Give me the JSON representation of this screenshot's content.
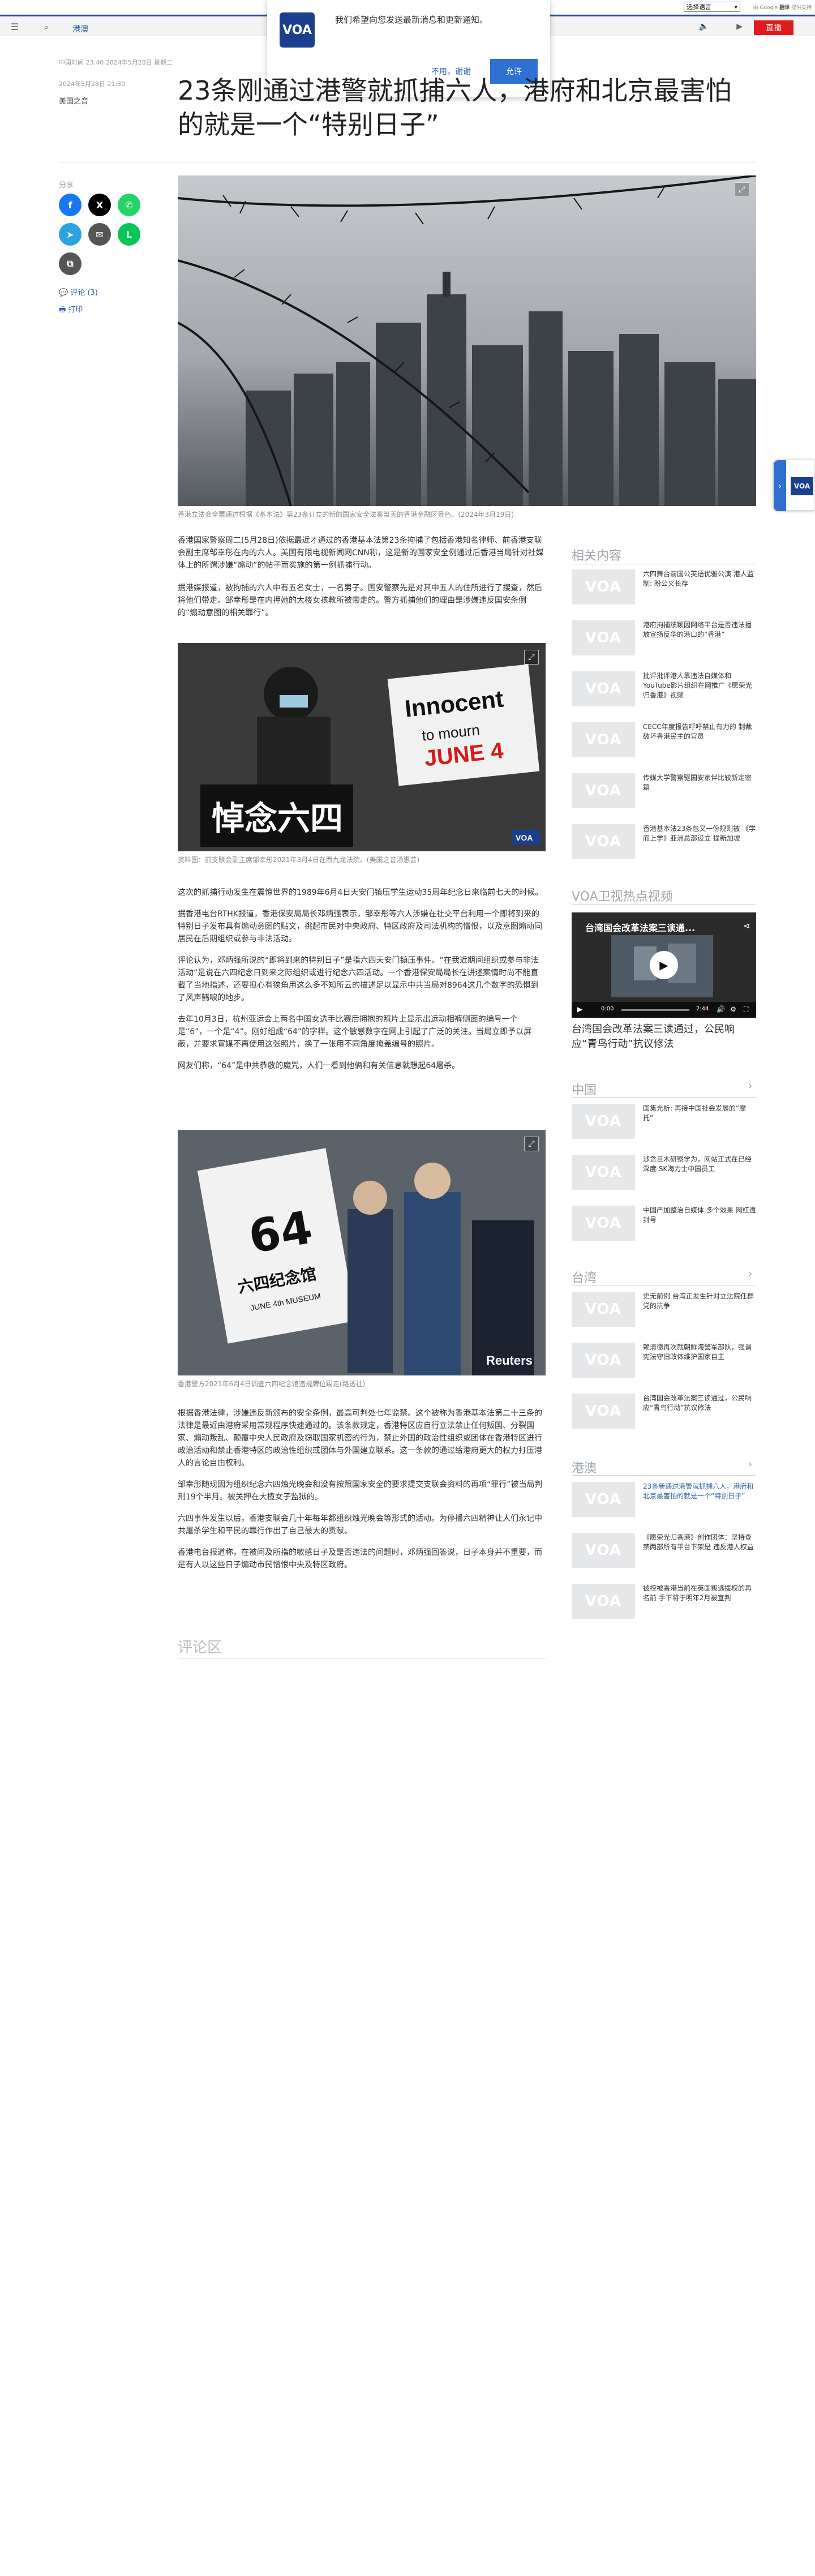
{
  "topbar": {
    "language_select": "选择语言",
    "powered_by": "由 Google",
    "powered_brand": "翻译",
    "powered_suffix": "提供支持"
  },
  "header": {
    "section": "港澳",
    "live_label": "直播"
  },
  "notification": {
    "logo": "VOA",
    "message": "我们希望向您发送最新消息和更新通知。",
    "decline": "不用，谢谢",
    "accept": "允许"
  },
  "article": {
    "meta_top": "中国时间 23:40 2024年5月28日 星期二",
    "date": "2024年5月28日 21:30",
    "byline": "美国之音",
    "headline": "23条刚通过港警就抓捕六人，港府和北京最害怕的就是一个“特别日子”",
    "share_label": "分享",
    "comments_link": "评论 (3)",
    "print_link": "打印",
    "hero_caption": "香港立法会全票通过根据《基本法》第23条订立的新的国家安全法案当天的香港金融区景色。(2024年3月19日)",
    "paragraphs_1": [
      "香港国家警察周二(5月28日)依据最近才通过的香港基本法第23条拘捕了包括香港知名律师、前香港支联会副主席邹幸彤在内的六人。美国有限电视新闻网CNN称，这是新的国家安全例通过后香港当局针对社媒体上的所谓涉嫌“煽动”的帖子而实施的第一例抓捕行动。",
      "据港媒报道，被拘捕的六人中有五名女士，一名男子。国安警察先是对其中五人的住所进行了搜查，然后将他们带走。邹幸彤是在内押她的大楼女孩教所被带走的。警方抓捕他们的理由是涉嫌违反国安条例的“煽动意图的相关罪行”。"
    ],
    "photo1_caption": "资料图：前支联会副主席邹幸彤2021年3月4日在西九龙法院。(美国之音汤惠芸)",
    "paragraphs_2": [
      "这次的抓捕行动发生在震惊世界的1989年6月4日天安门镇压学生运动35周年纪念日来临前七天的时候。",
      "据香港电台RTHK报道，香港保安局局长邓炳强表示，邹幸彤等六人涉嫌在社交平台利用一个即将到来的特别日子发布具有煽动意图的贴文，挑起市民对中央政府、特区政府及司法机构的憎恨，以及意图煽动同居民在后期组织或参与非法活动。",
      "评论认为，邓炳强所说的“即将到来的特别日子”是指六四天安门镇压事件。“在我近期间组织或参与非法活动”是说在六四纪念日到来之际组织或进行纪念六四活动。一个香港保安局局长在讲述案情时尚不能直截了当地指述，还要担心有狭角用这么多不知所云的描述足以显示中共当局对8964这几个数字的恐惧到了风声鹤唳的地步。",
      "去年10月3日，杭州亚运会上两名中国女选手比赛后拥抱的照片上显示出运动相裤侧面的编号一个是“6”，一个是“4”。刚好组成“64”的字样。这个敏感数字在网上引起了广泛的关注。当局立即予以屏蔽，并要求宣媒不再使用这张照片，换了一张用不同角度掩盖编号的照片。",
      "网友们称，“64”是中共恭敬的魔咒，人们一看到他俩和有关信息就想起64屠杀。"
    ],
    "photo2_caption": "香港警方2021年6月4日调查六四纪念馆违规牌位踢走(路透社)",
    "paragraphs_3": [
      "根据香港法律，涉嫌违反新颁布的安全条例，最高可判处七年监禁。这个被称为香港基本法第二十三条的法律是最近由港府采用常规程序快速通过的。该条款规定，香港特区应自行立法禁止任何叛国、分裂国家、煽动叛乱、颠覆中央人民政府及窃取国家机密的行为，禁止外国的政治性组织或团体在香港特区进行政治活动和禁止香港特区的政治性组织或团体与外国建立联系。这一条款的通过给港府更大的权力打压港人的言论自由权利。",
      "邹幸彤随现因为组织纪念六四烛光晚会和没有按照国家安全的要求提交支联会资料的再项“罪行”被当局判刑19个半月。被关押在大榄女子监狱的。",
      "六四事件发生以后，香港支联会几十年每年都组织烛光晚会等形式的活动。为停播六四精神让人们永记中共屠杀学生和平民的罪行作出了自己最大的贡献。",
      "香港电台报道称，在被问及所指的敏感日子及是否违法的问题时，邓炳强回答说，日子本身并不重要，而是有人以这些日子煽动市民憎恨中央及特区政府。"
    ],
    "comments_heading": "评论区"
  },
  "sidebar": {
    "related_heading": "相关内容",
    "related": [
      "六四舞台前国公英语优雅公演 港人监制: 盼公义长存",
      "港府拘捕绩颖因网络平台是否违法播放宣扬反华的港口的“香港”",
      "批评批评港人靠违法自媒体和 YouTube影片组织在网推广《愿荣光归香港》视频",
      "CECC年度报告呼吁禁止有力的 制裁破坏香港民主的官员",
      "传媒大学警察驱国安家伴比较新定密籍",
      "香港基本法23条包又一份规则被 《学而上学》亚洲总部设立 提新加坡"
    ],
    "video_heading": "VOA卫视热点视频",
    "video_overlay": "台湾国会改革法案三读通...",
    "video_time": "2:44",
    "video_time_start": "0:00",
    "video_title": "台湾国会改革法案三读通过，公民响应“青鸟行动”抗议修法",
    "china_heading": "中国",
    "china": [
      "国集光析: 再接中国社会发展的“摩托”",
      "涉贪巨木研察学为，网站正式在已经深度 SK海力士中国员工",
      "中国严加整治自媒体 多个效果 网红遭封号"
    ],
    "taiwan_heading": "台湾",
    "taiwan": [
      "史无前例 台湾正发生针对立法院任群党的抗争",
      "赖清德再次就朝鲜海警军部队，强调宪法守旧政体维护国家自主",
      "台湾国会改革法案三读通过，公民响应“青鸟行动”抗议修法"
    ],
    "hk_heading": "港澳",
    "hk": [
      "23条新通过港警就抓捕六人，港府和北京最害怕的就是一个“特别日子”",
      "《愿荣光归香港》创作团体：坚持查禁两部所有平台下架是 违反港人权益",
      "被控被香港当前在英国叛逃援权的再名前 手下将于明年2月被宣判"
    ],
    "float_logo": "VOA"
  },
  "colors": {
    "brand_blue": "#1f4e9a",
    "live_red": "#e01b1b",
    "link_blue": "#2d5fa8"
  }
}
